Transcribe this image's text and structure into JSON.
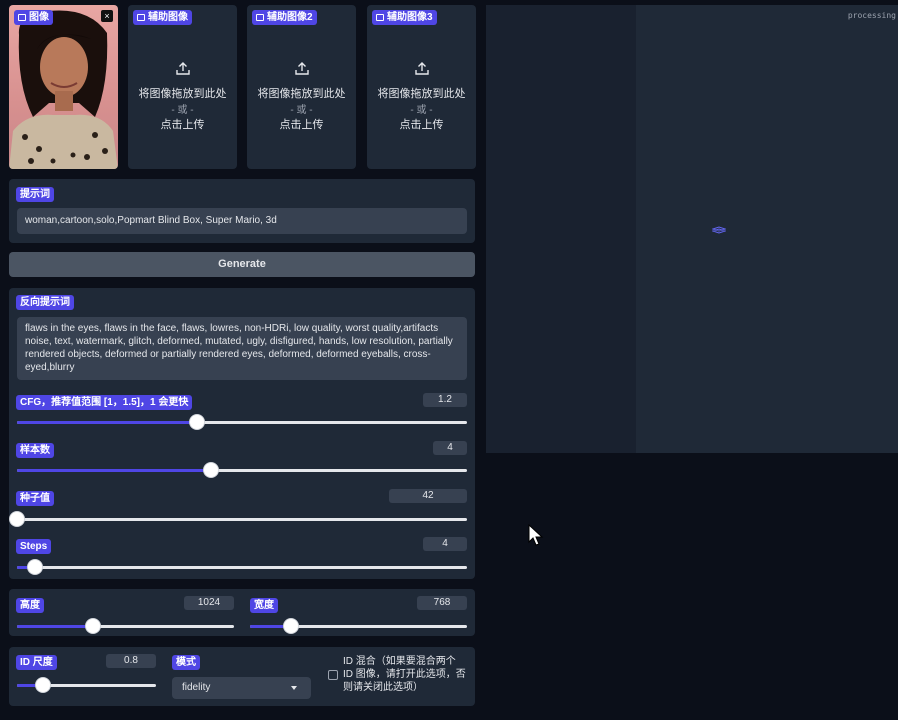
{
  "image_inputs": {
    "main": {
      "label": "图像"
    },
    "aux1": {
      "label": "辅助图像",
      "drop_text": "将图像拖放到此处",
      "or_text": "- 或 -",
      "click_text": "点击上传"
    },
    "aux2": {
      "label": "辅助图像2",
      "drop_text": "将图像拖放到此处",
      "or_text": "- 或 -",
      "click_text": "点击上传"
    },
    "aux3": {
      "label": "辅助图像3",
      "drop_text": "将图像拖放到此处",
      "or_text": "- 或 -",
      "click_text": "点击上传"
    },
    "close_glyph": "×"
  },
  "prompt": {
    "label": "提示词",
    "value": "woman,cartoon,solo,Popmart Blind Box, Super Mario, 3d"
  },
  "generate_button": "Generate",
  "negative_prompt": {
    "label": "反向提示词",
    "value": "flaws in the eyes, flaws in the face, flaws, lowres, non-HDRi, low quality, worst quality,artifacts noise, text, watermark, glitch, deformed, mutated, ugly, disfigured, hands, low resolution, partially rendered objects,  deformed or partially rendered eyes, deformed, deformed eyeballs, cross-eyed,blurry"
  },
  "sliders": {
    "cfg": {
      "label": "CFG，推荐值范围 [1，1.5]，1 会更快",
      "value": "1.2",
      "level": 0.4
    },
    "samples": {
      "label": "样本数",
      "value": "4",
      "level": 0.43
    },
    "seed": {
      "label": "种子值",
      "value": "42",
      "level": 0.0
    },
    "steps": {
      "label": "Steps",
      "value": "4",
      "level": 0.04
    },
    "height": {
      "label": "高度",
      "value": "1024",
      "level": 0.35
    },
    "width": {
      "label": "宽度",
      "value": "768",
      "level": 0.19
    },
    "id_scale": {
      "label": "ID 尺度",
      "value": "0.8",
      "level": 0.19
    }
  },
  "mode": {
    "label": "模式",
    "selected": "fidelity"
  },
  "id_mix": {
    "label": "ID 混合（如果要混合两个 ID 图像，请打开此选项，否则请关闭此选项）",
    "checked": false
  },
  "output": {
    "status": "processing"
  },
  "colors": {
    "accent": "#4f46e5",
    "panel": "#1f2937",
    "background": "#0b0f19"
  },
  "icons": [
    "image-icon",
    "close-icon",
    "upload-icon",
    "dropdown-caret-icon",
    "loading-spinner-icon",
    "mouse-cursor-icon"
  ]
}
